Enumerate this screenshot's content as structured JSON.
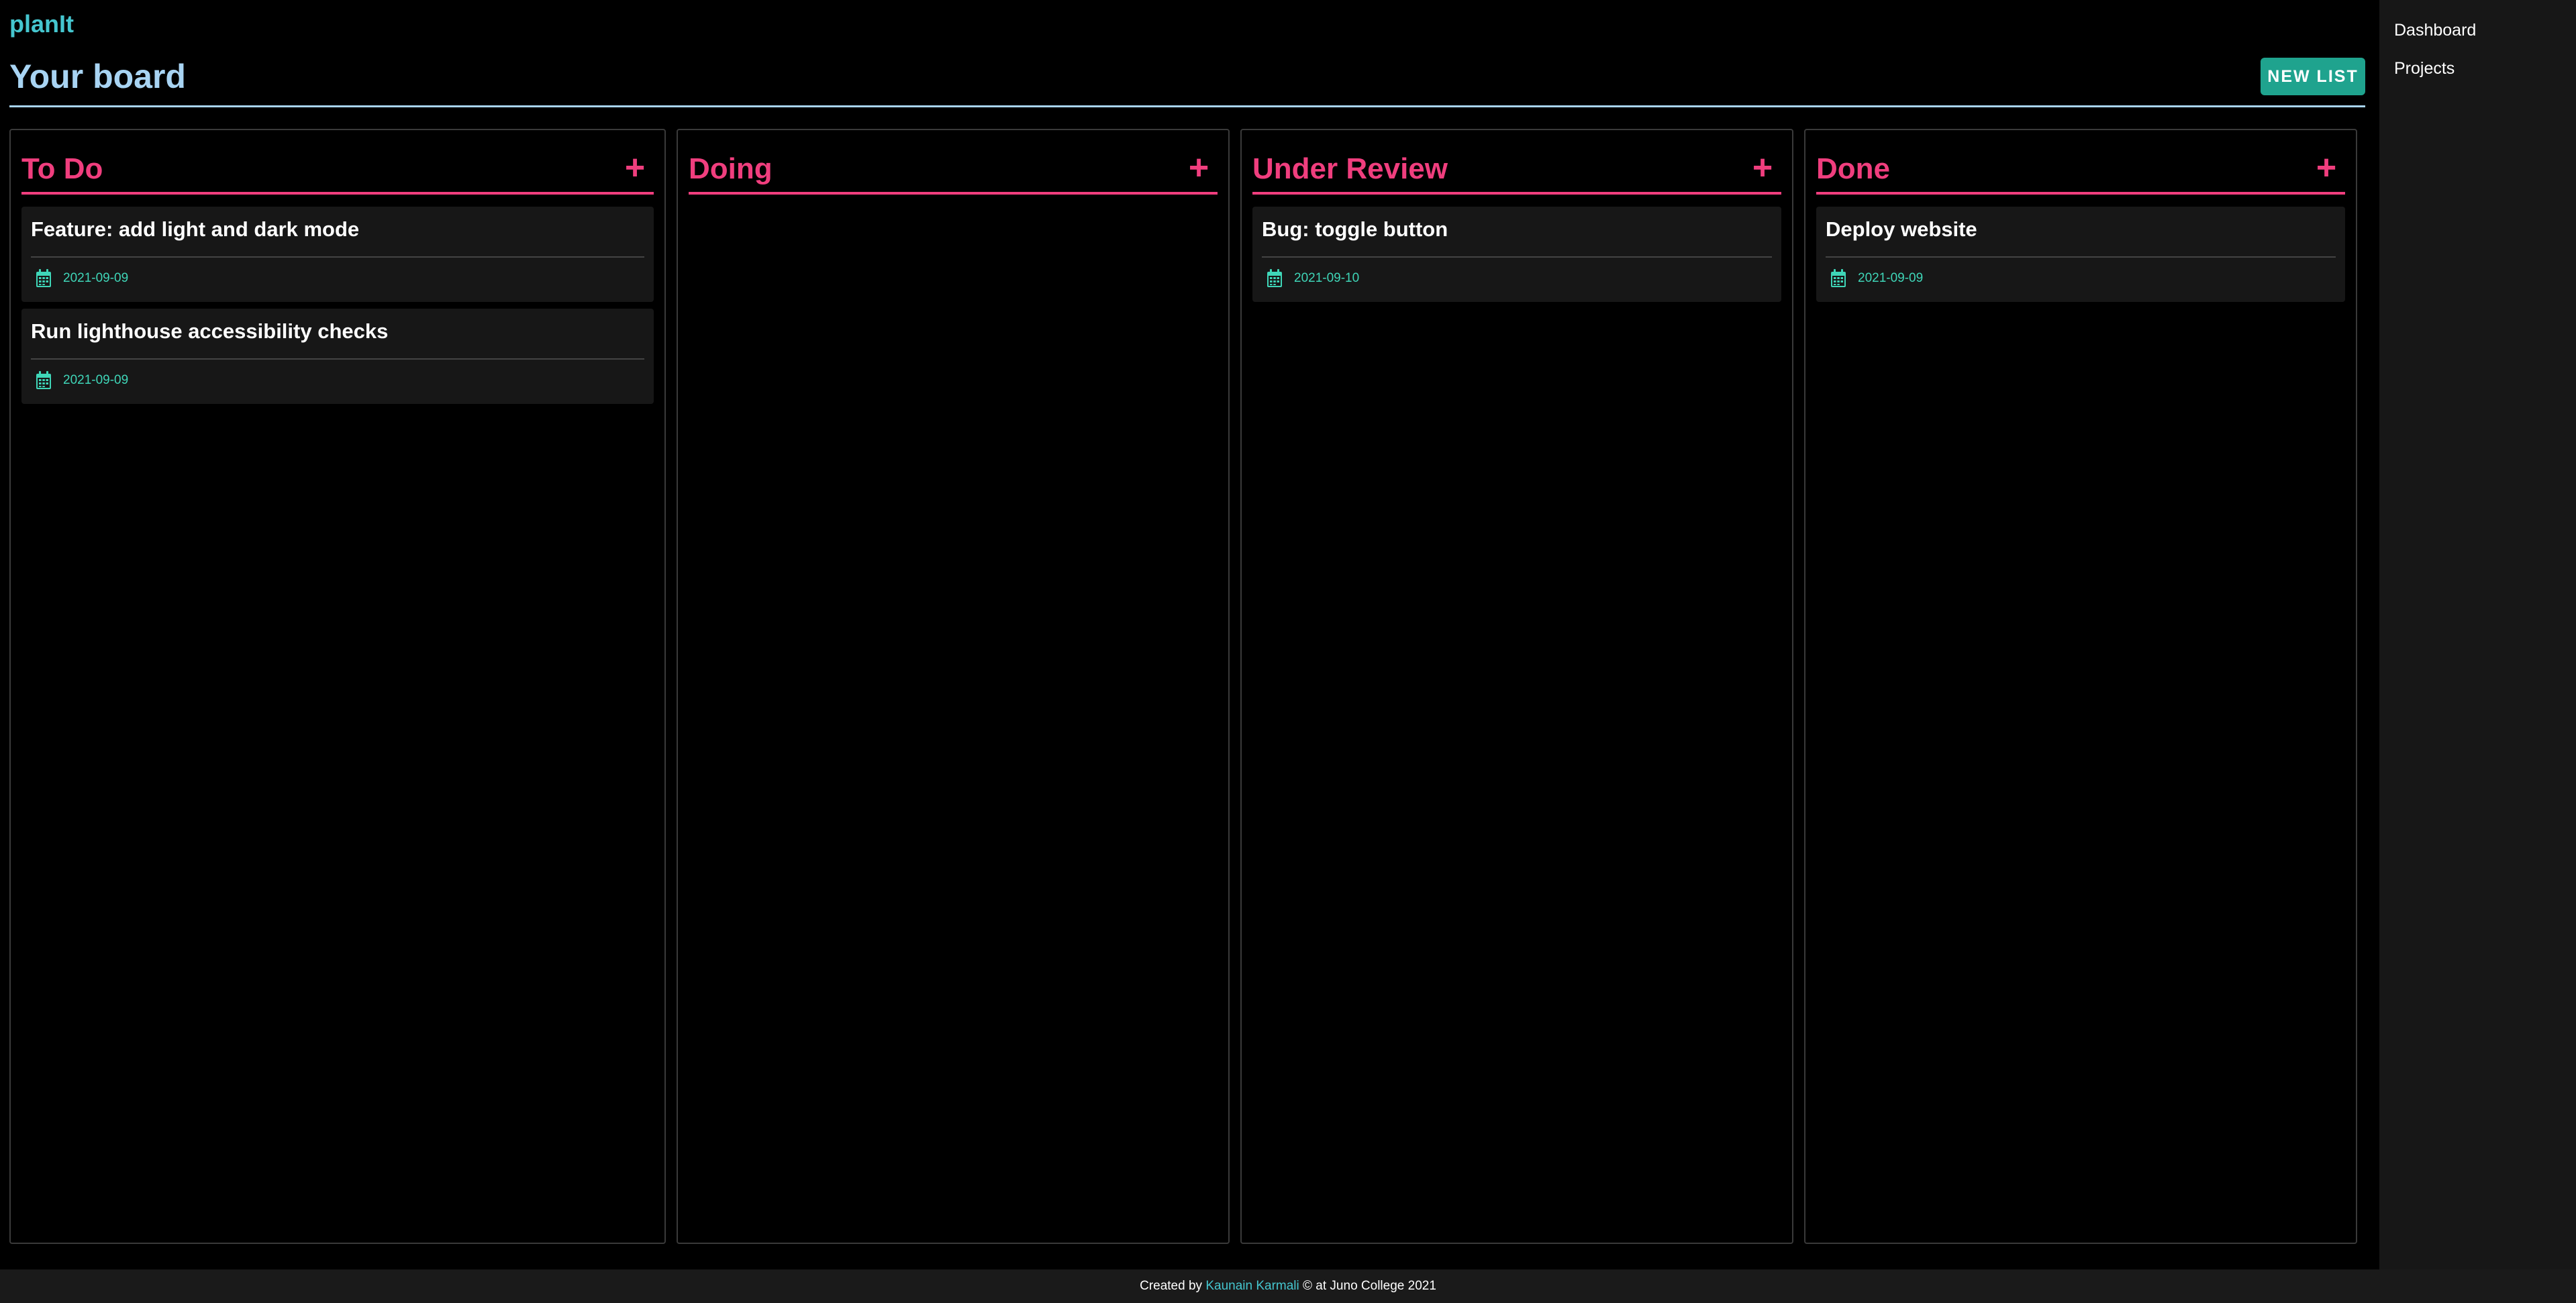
{
  "app": {
    "logo": "planIt",
    "page_title": "Your board",
    "new_list_label": "NEW LIST"
  },
  "colors": {
    "accent_pink": "#f03e7e",
    "accent_teal": "#1fa38e",
    "logo_cyan": "#45c6cf",
    "title_blue": "#a8d4f3",
    "date_green": "#3fd6b8"
  },
  "sidebar": {
    "items": [
      {
        "label": "Dashboard"
      },
      {
        "label": "Projects"
      }
    ]
  },
  "columns": [
    {
      "title": "To Do",
      "add_icon": "plus-icon",
      "cards": [
        {
          "title": "Feature: add light and dark mode",
          "date": "2021-09-09",
          "icon": "calendar-icon"
        },
        {
          "title": "Run lighthouse accessibility checks",
          "date": "2021-09-09",
          "icon": "calendar-icon"
        }
      ]
    },
    {
      "title": "Doing",
      "add_icon": "plus-icon",
      "cards": []
    },
    {
      "title": "Under Review",
      "add_icon": "plus-icon",
      "cards": [
        {
          "title": "Bug: toggle button",
          "date": "2021-09-10",
          "icon": "calendar-icon"
        }
      ]
    },
    {
      "title": "Done",
      "add_icon": "plus-icon",
      "cards": [
        {
          "title": "Deploy website",
          "date": "2021-09-09",
          "icon": "calendar-icon"
        }
      ]
    }
  ],
  "footer": {
    "prefix": "Created by",
    "author": "Kaunain Karmali",
    "suffix": "© at Juno College 2021"
  }
}
